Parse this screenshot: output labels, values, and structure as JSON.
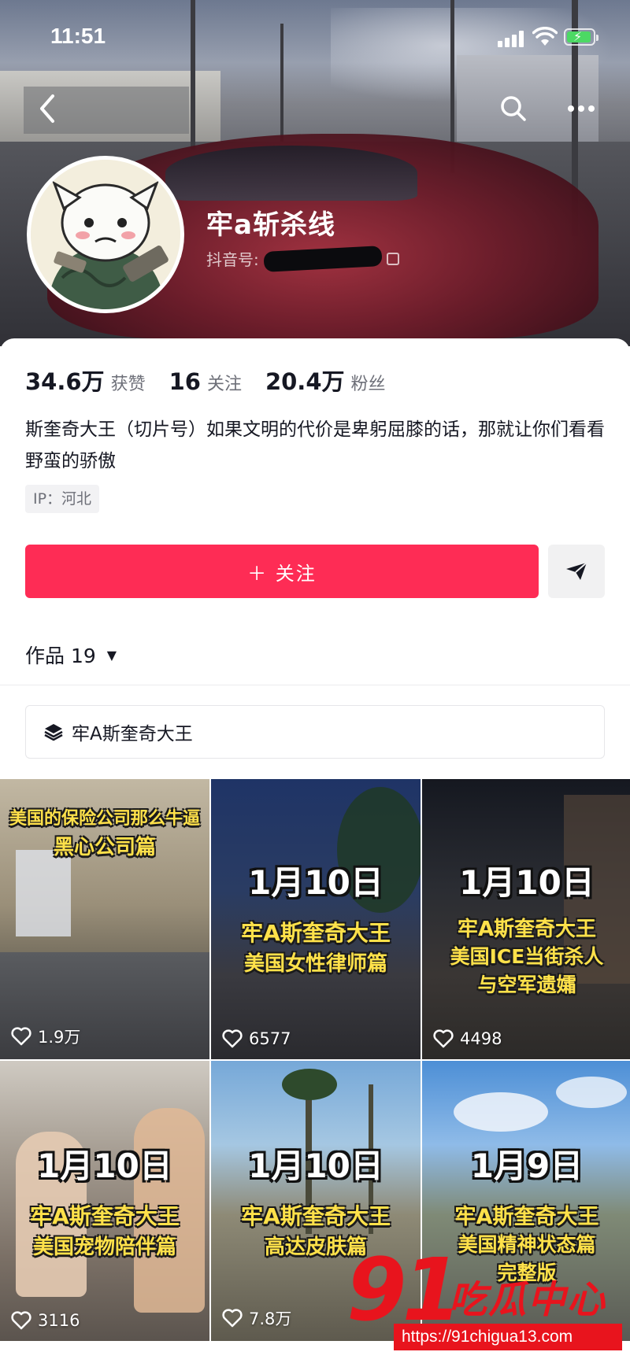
{
  "status_bar": {
    "time": "11:51"
  },
  "profile": {
    "nickname": "牢a斩杀线",
    "id_label": "抖音号:"
  },
  "stats": [
    {
      "value": "34.6万",
      "label": "获赞"
    },
    {
      "value": "16",
      "label": "关注"
    },
    {
      "value": "20.4万",
      "label": "粉丝"
    }
  ],
  "bio": "斯奎奇大王（切片号）如果文明的代价是卑躬屈膝的话，那就让你们看看野蛮的骄傲",
  "ip": "IP：河北",
  "follow_button": "＋ 关注",
  "works_tab": {
    "label": "作品 19"
  },
  "collection": {
    "label": "牢A斯奎奇大王"
  },
  "videos": [
    {
      "caption_top": "美国的保险公司那么牛逼",
      "caption_sub": "黑心公司篇",
      "date": "",
      "title1": "",
      "title2": "",
      "likes": "1.9万"
    },
    {
      "caption_top": "",
      "caption_sub": "",
      "date": "1月10日",
      "title1": "牢A斯奎奇大王",
      "title2": "美国女性律师篇",
      "likes": "6577"
    },
    {
      "caption_top": "",
      "caption_sub": "",
      "date": "1月10日",
      "title1": "牢A斯奎奇大王",
      "title2": "美国ICE当街杀人",
      "title3": "与空军遗孀",
      "likes": "4498"
    },
    {
      "caption_top": "",
      "caption_sub": "",
      "date": "1月10日",
      "title1": "牢A斯奎奇大王",
      "title2": "美国宠物陪伴篇",
      "likes": "3116"
    },
    {
      "caption_top": "",
      "caption_sub": "",
      "date": "1月10日",
      "title1": "牢A斯奎奇大王",
      "title2": "高达皮肤篇",
      "likes": "7.8万"
    },
    {
      "caption_top": "",
      "caption_sub": "",
      "date": "1月9日",
      "title1": "牢A斯奎奇大王",
      "title2": "美国精神状态篇",
      "title3": "完整版",
      "likes": ""
    }
  ],
  "watermark": {
    "number": "91",
    "text": "吃瓜中心",
    "url": "https://91chigua13.com"
  },
  "colors": {
    "follow": "#fe2c55",
    "caption_yellow": "#ffe14a",
    "watermark_red": "#e8141d"
  }
}
